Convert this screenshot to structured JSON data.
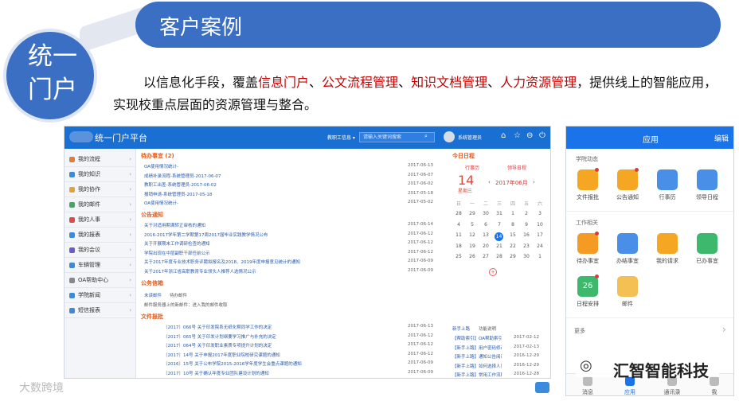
{
  "header": {
    "banner_title": "客户案例",
    "circle_title": "统一门户"
  },
  "description": {
    "prefix": "以信息化手段，覆盖",
    "highlights": [
      "信息门户",
      "公文流程管理",
      "知识文档管理",
      "人力资源管理"
    ],
    "sep": "、",
    "suffix": "，提供线上的智能应用，实现校重点层面的资源管理与整合。"
  },
  "portal": {
    "title": "统一门户平台",
    "search_scope": "教职工信息 ▾",
    "search_placeholder": "请输入关键词搜索",
    "user": "系统管理员",
    "sidebar": [
      {
        "label": "我的流程",
        "color": "#e07b39"
      },
      {
        "label": "我的知识",
        "color": "#3c8ad8"
      },
      {
        "label": "我的协作",
        "color": "#e5a23a"
      },
      {
        "label": "我的邮件",
        "color": "#4aa36b"
      },
      {
        "label": "我的人事",
        "color": "#d94c4c"
      },
      {
        "label": "我的报表",
        "color": "#3c8ad8"
      },
      {
        "label": "我的会议",
        "color": "#6a5acd"
      },
      {
        "label": "车辆管理",
        "color": "#3c8ad8"
      },
      {
        "label": "OA帮助中心",
        "color": "#888"
      },
      {
        "label": "学院新闻",
        "color": "#3c8ad8"
      },
      {
        "label": "短信报表",
        "color": "#3c8ad8"
      }
    ],
    "todo": {
      "title": "待办事宜 (2)",
      "items": [
        {
          "t": "OA使用情况统计-",
          "d": "2017-06-13",
          "n": "2017-06-13"
        },
        {
          "t": "成绩补录流程-系统管理员-2017-06-07",
          "d": "",
          "n": "2017-06-07"
        },
        {
          "t": "教职工出差-系统管理员-2017-06-02",
          "d": "",
          "n": "2017-06-02"
        },
        {
          "t": "报销申请-系统管理员-2017-05-18",
          "d": "",
          "n": "2017-05-18"
        },
        {
          "t": "OA使用情况统计-",
          "d": "2017-05-02",
          "n": "2017-05-02"
        }
      ]
    },
    "notice": {
      "title": "公告通知",
      "items": [
        {
          "t": "关于对适用期满转正审核的通知",
          "n": "2017-06-14"
        },
        {
          "t": "2016-2017学年第二学期第17周2017届毕业实践教学情况公布",
          "n": "2017-06-12"
        },
        {
          "t": "关于开展期末工作调研检查的通知",
          "n": "2017-06-12"
        },
        {
          "t": "学院出现在中层副职干部任前公示",
          "n": "2017-06-12"
        },
        {
          "t": "关于2017年度专业技术职务评聘拟报名及2018、2019年度申报意见统计的通知",
          "n": "2017-06-09"
        },
        {
          "t": "关于2017年浙江省高职教育专业领头人推荐人选情况公示",
          "n": "2017-06-09"
        }
      ]
    },
    "mail": {
      "title": "公务信箱",
      "tabs": [
        "未读邮件",
        "待办邮件"
      ],
      "line": "邮件服务器上的新邮件：进入我的邮件收取"
    },
    "docs": {
      "title": "文件报批",
      "items": [
        {
          "t": "〔2017〕066号 关于印发院系无纸化帮同学工作的决定",
          "n": "2017-06-13"
        },
        {
          "t": "〔2017〕065号 关于印发计划纲要学习推广与补充的决定",
          "n": "2017-06-12"
        },
        {
          "t": "〔2017〕064号 关于印发职业素质专项提升计划的决定",
          "n": "2017-06-12"
        },
        {
          "t": "〔2017〕14号 关于申报2017年度职业院校研究课题的通知",
          "n": "2017-06-12"
        },
        {
          "t": "〔2016〕15号 关于公布学院2015-2016学年度学生会重点课题的通知",
          "n": "2017-06-09"
        },
        {
          "t": "〔2017〕10号 关于确认年度专业团队建设计划的通知",
          "n": "2017-06-09"
        }
      ]
    },
    "calendar": {
      "title": "今日日程",
      "col_a": "行事历",
      "col_b": "领导日程",
      "day": "14",
      "weekday": "星期三",
      "month": "2017年06月",
      "weekhead": [
        "日",
        "一",
        "二",
        "三",
        "四",
        "五",
        "六"
      ],
      "rows": [
        [
          "28",
          "29",
          "30",
          "31",
          "1",
          "2",
          "3"
        ],
        [
          "4",
          "5",
          "6",
          "7",
          "8",
          "9",
          "10"
        ],
        [
          "11",
          "12",
          "13",
          "14",
          "15",
          "16",
          "17"
        ],
        [
          "18",
          "19",
          "20",
          "21",
          "22",
          "23",
          "24"
        ],
        [
          "25",
          "26",
          "27",
          "28",
          "29",
          "30",
          "1"
        ]
      ]
    },
    "help": {
      "tabs": [
        "新手上路",
        "功能说明"
      ],
      "items": [
        {
          "t": "【帮助索引】OA帮助索引",
          "n": "2017-02-12"
        },
        {
          "t": "【新手上路】用户密码修改",
          "n": "2017-02-13"
        },
        {
          "t": "【新手上路】通知公告阅读和查看",
          "n": "2016-12-29"
        },
        {
          "t": "【新手上路】如何选择人员",
          "n": "2016-12-29"
        },
        {
          "t": "【新手上路】常用工作流程",
          "n": "2016-12-28"
        },
        {
          "t": "【新手上路】用户登录设置",
          "n": "2016-12-28"
        }
      ]
    }
  },
  "app": {
    "title": "应用",
    "edit": "编辑",
    "section1": "学院动态",
    "apps1": [
      {
        "l": "文件报批",
        "c": "#f5a623"
      },
      {
        "l": "公告通知",
        "c": "#f5a623"
      },
      {
        "l": "行事历",
        "c": "#4a8fe7"
      },
      {
        "l": "领导日程",
        "c": "#4a8fe7"
      }
    ],
    "section2": "工作相关",
    "apps2": [
      {
        "l": "待办事宜",
        "c": "#f59a23"
      },
      {
        "l": "办结事宜",
        "c": "#4a8fe7"
      },
      {
        "l": "我的请求",
        "c": "#f5a623"
      },
      {
        "l": "已办事宜",
        "c": "#3db86c"
      }
    ],
    "apps3": [
      {
        "l": "日程安排",
        "c": "#3db86c",
        "t": "26"
      },
      {
        "l": "邮件",
        "c": "#f5c053"
      }
    ],
    "more": "更多",
    "tabs": [
      "消息",
      "应用",
      "通讯录",
      "我"
    ]
  },
  "watermark": {
    "brand": "汇智智能科技",
    "corner": "大数跨境"
  }
}
